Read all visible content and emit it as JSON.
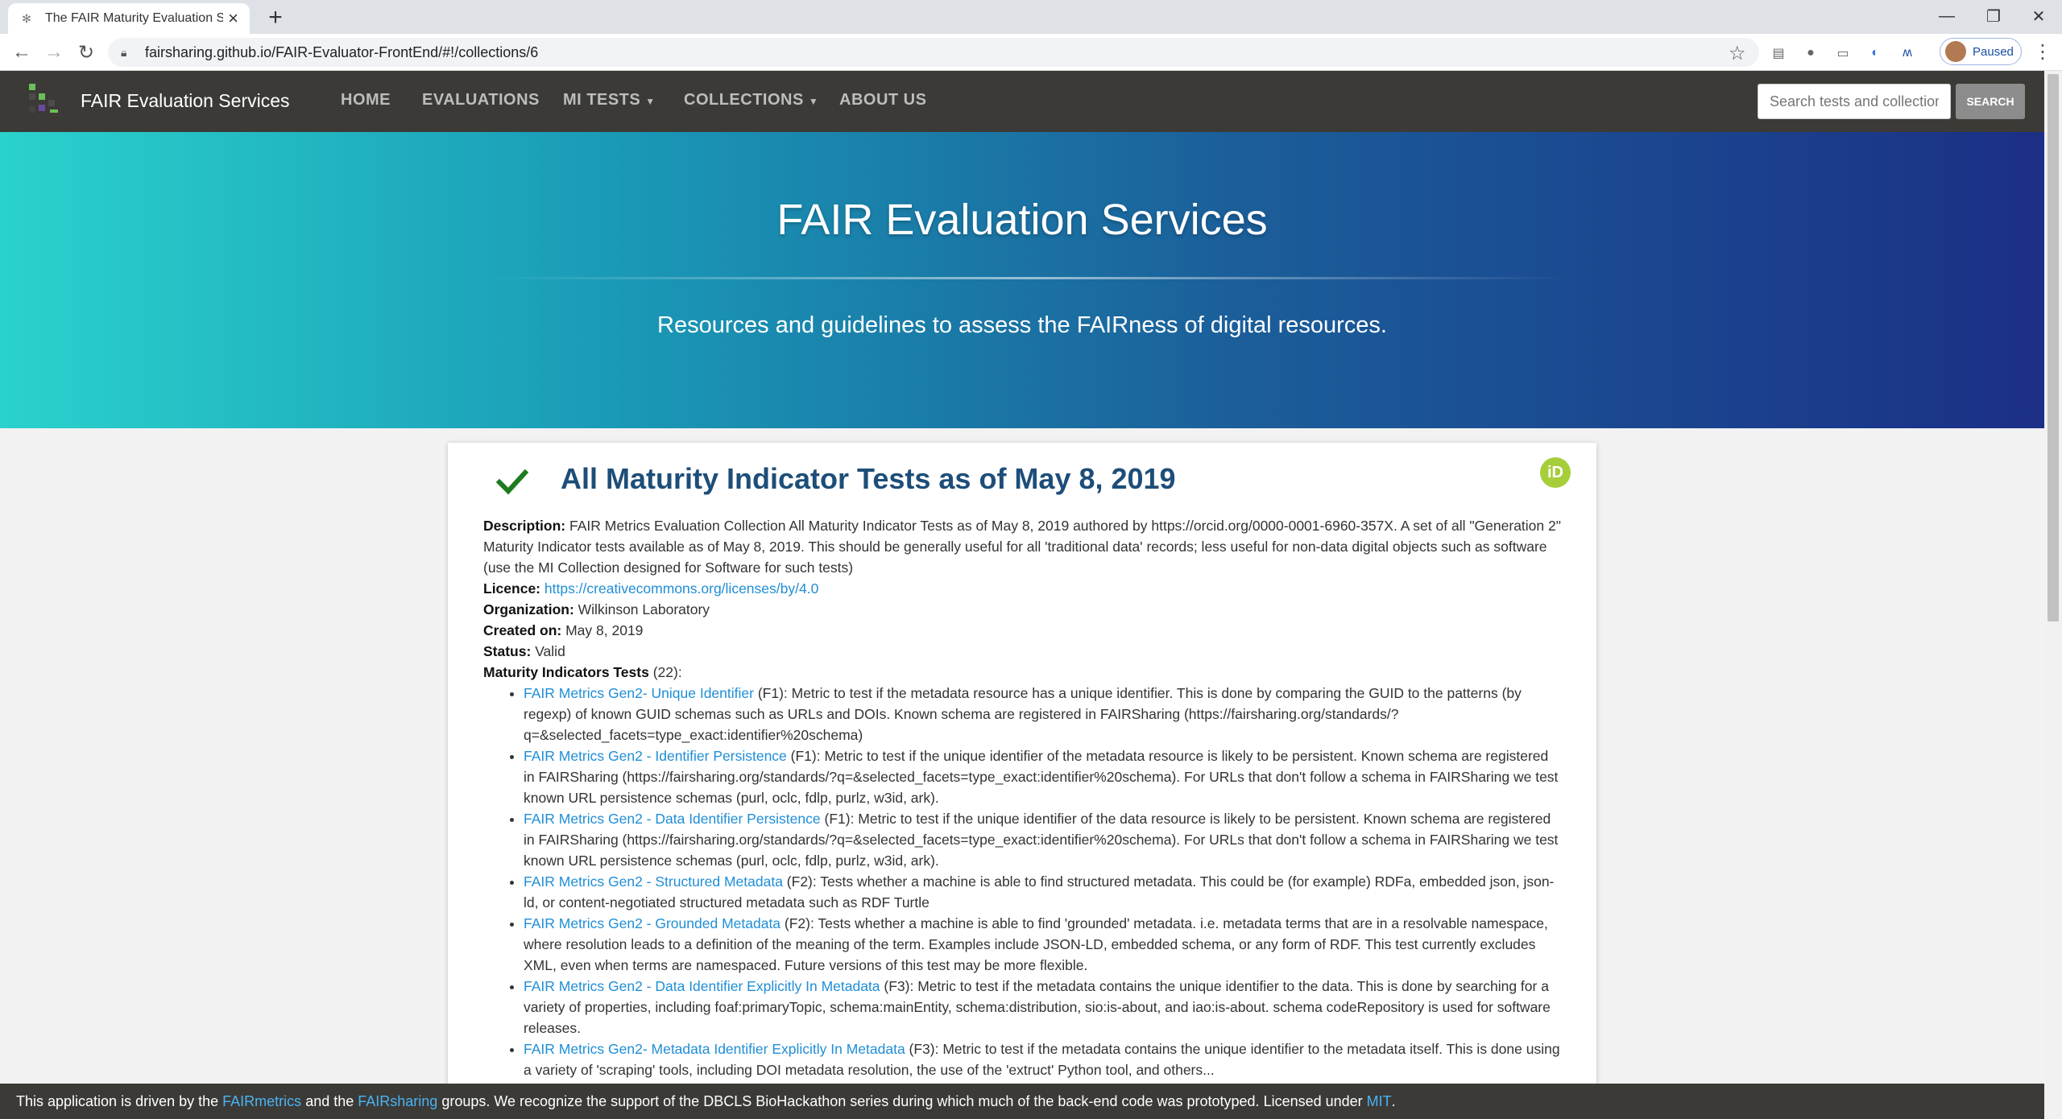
{
  "browser": {
    "tab_title": "The FAIR Maturity Evaluation Ser",
    "url": "fairsharing.github.io/FAIR-Evaluator-FrontEnd/#!/collections/6",
    "profile_status": "Paused"
  },
  "navbar": {
    "brand": "FAIR Evaluation Services",
    "links": [
      "HOME",
      "EVALUATIONS",
      "MI TESTS",
      "COLLECTIONS",
      "ABOUT US"
    ],
    "search_placeholder": "Search tests and collections",
    "search_button": "SEARCH"
  },
  "hero": {
    "title": "FAIR Evaluation Services",
    "subtitle": "Resources and guidelines to assess the FAIRness of digital resources."
  },
  "collection": {
    "title": "All Maturity Indicator Tests as of May 8, 2019",
    "description_label": "Description:",
    "description": "FAIR Metrics Evaluation Collection All Maturity Indicator Tests as of May 8, 2019 authored by https://orcid.org/0000-0001-6960-357X. A set of all \"Generation 2\" Maturity Indicator tests available as of May 8, 2019. This should be generally useful for all 'traditional data' records; less useful for non-data digital objects such as software (use the MI Collection designed for Software for such tests)",
    "licence_label": "Licence:",
    "licence": "https://creativecommons.org/licenses/by/4.0",
    "organization_label": "Organization:",
    "organization": "Wilkinson Laboratory",
    "created_label": "Created on:",
    "created": "May 8, 2019",
    "status_label": "Status:",
    "status": "Valid",
    "tests_label": "Maturity Indicators Tests",
    "tests_count": "(22):",
    "tests": [
      {
        "name": "FAIR Metrics Gen2- Unique Identifier",
        "desc": " (F1): Metric to test if the metadata resource has a unique identifier. This is done by comparing the GUID to the patterns (by regexp) of known GUID schemas such as URLs and DOIs. Known schema are registered in FAIRSharing (https://fairsharing.org/standards/?q=&selected_facets=type_exact:identifier%20schema)"
      },
      {
        "name": "FAIR Metrics Gen2 - Identifier Persistence",
        "desc": " (F1): Metric to test if the unique identifier of the metadata resource is likely to be persistent. Known schema are registered in FAIRSharing (https://fairsharing.org/standards/?q=&selected_facets=type_exact:identifier%20schema). For URLs that don't follow a schema in FAIRSharing we test known URL persistence schemas (purl, oclc, fdlp, purlz, w3id, ark)."
      },
      {
        "name": "FAIR Metrics Gen2 - Data Identifier Persistence",
        "desc": " (F1): Metric to test if the unique identifier of the data resource is likely to be persistent. Known schema are registered in FAIRSharing (https://fairsharing.org/standards/?q=&selected_facets=type_exact:identifier%20schema). For URLs that don't follow a schema in FAIRSharing we test known URL persistence schemas (purl, oclc, fdlp, purlz, w3id, ark)."
      },
      {
        "name": "FAIR Metrics Gen2 - Structured Metadata",
        "desc": " (F2): Tests whether a machine is able to find structured metadata. This could be (for example) RDFa, embedded json, json-ld, or content-negotiated structured metadata such as RDF Turtle"
      },
      {
        "name": "FAIR Metrics Gen2 - Grounded Metadata",
        "desc": " (F2): Tests whether a machine is able to find 'grounded' metadata. i.e. metadata terms that are in a resolvable namespace, where resolution leads to a definition of the meaning of the term. Examples include JSON-LD, embedded schema, or any form of RDF. This test currently excludes XML, even when terms are namespaced. Future versions of this test may be more flexible."
      },
      {
        "name": "FAIR Metrics Gen2 - Data Identifier Explicitly In Metadata",
        "desc": " (F3): Metric to test if the metadata contains the unique identifier to the data. This is done by searching for a variety of properties, including foaf:primaryTopic, schema:mainEntity, schema:distribution, sio:is-about, and iao:is-about. schema codeRepository is used for software releases."
      },
      {
        "name": "FAIR Metrics Gen2- Metadata Identifier Explicitly In Metadata",
        "desc": " (F3): Metric to test if the metadata contains the unique identifier to the metadata itself. This is done using a variety of 'scraping' tools, including DOI metadata resolution, the use of the 'extruct' Python tool, and others..."
      }
    ]
  },
  "footer": {
    "text1": "This application is driven by the ",
    "link1": "FAIRmetrics",
    "text2": " and the ",
    "link2": "FAIRsharing",
    "text3": " groups. We recognize the support of the DBCLS BioHackathon series during which much of the back-end code was prototyped. Licensed under ",
    "link3": "MIT",
    "text4": "."
  },
  "colors": {
    "navbar_bg": "#3b3a36",
    "title_blue": "#1d4e79",
    "link_blue": "#1f8ed6",
    "check_green": "#1e7b1e",
    "orcid_green": "#a6ce39"
  }
}
